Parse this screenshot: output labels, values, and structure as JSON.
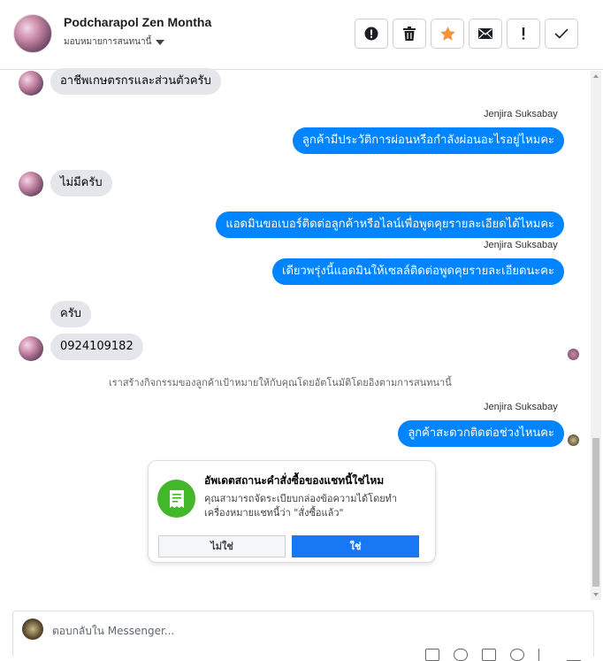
{
  "header": {
    "contact_name": "Podcharapol Zen Montha",
    "assign_label": "มอบหมายการสนทนานี้"
  },
  "toolbar": {
    "buttons": [
      {
        "name": "spam-button",
        "icon": "alert-circle-icon"
      },
      {
        "name": "delete-button",
        "icon": "trash-icon"
      },
      {
        "name": "star-button",
        "icon": "star-icon",
        "color": "#f7923a"
      },
      {
        "name": "unread-button",
        "icon": "envelope-icon"
      },
      {
        "name": "follow-up-button",
        "icon": "exclamation-icon"
      },
      {
        "name": "done-button",
        "icon": "check-icon"
      }
    ]
  },
  "messages": {
    "m1": "อาชีพเกษตรกรและส่วนตัวครับ",
    "sender_a": "Jenjira Suksabay",
    "m2": "ลูกค้ามีประวัติการผ่อนหรือกำลังผ่อนอะไรอยู่ไหมคะ",
    "m3": "ไม่มีครับ",
    "m4": "แอดมินขอเบอร์ติดต่อลูกค้าหรือไลน์เพื่อพูดคุยรายละเอียดได้ไหมคะ",
    "sender_b": "Jenjira Suksabay",
    "m5": "เดียวพรุ่งนี้แอดมินให้เซลล์ติดต่อพูดคุยรายละเอียดนะคะ",
    "m6": "ครับ",
    "m7": "0924109182",
    "system_note": "เราสร้างกิจกรรมของลูกค้าเป้าหมายให้กับคุณโดยอัตโนมัติโดยอิงตามการสนทนานี้",
    "sender_c": "Jenjira Suksabay",
    "m8": "ลูกค้าสะดวกติดต่อช่วงไหนคะ"
  },
  "order_card": {
    "title": "อัพเดตสถานะคำสั่งซื้อของแชทนี้ใช่ไหม",
    "body": "คุณสามารถจัดระเบียบกล่องข้อความได้โดยทำเครื่องหมายแชทนี้ว่า \"สั่งซื้อแล้ว\"",
    "no_label": "ไม่ใช่",
    "yes_label": "ใช่",
    "icon": "receipt-icon"
  },
  "composer": {
    "placeholder": "ตอบกลับใน Messenger..."
  },
  "colors": {
    "outgoing_bubble": "#0084ff",
    "incoming_bubble": "#e4e6eb",
    "primary_button": "#1877f2",
    "card_icon_bg": "#42b72a"
  }
}
